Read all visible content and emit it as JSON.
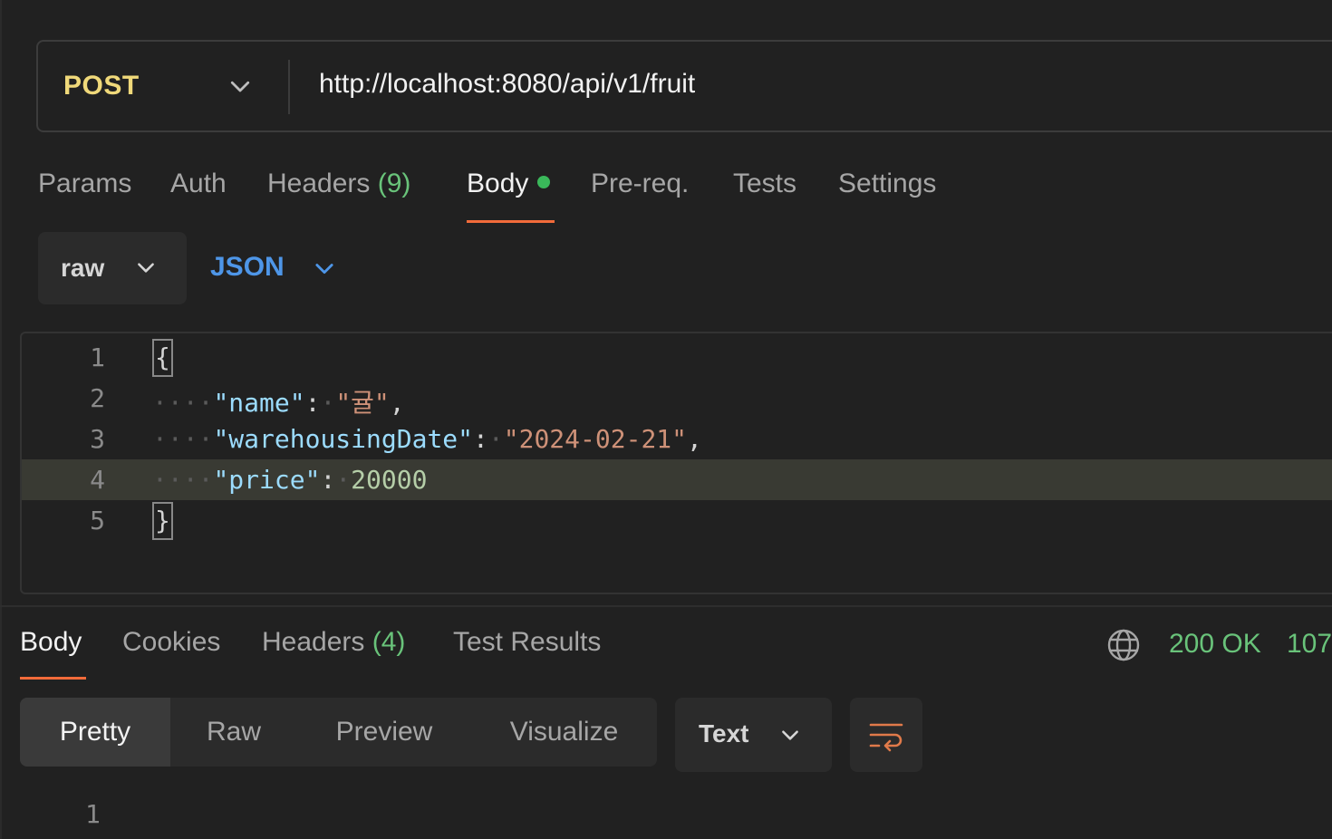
{
  "request": {
    "method": "POST",
    "url": "http://localhost:8080/api/v1/fruit"
  },
  "request_tabs": {
    "params": "Params",
    "auth": "Auth",
    "headers": "Headers",
    "headers_count": "(9)",
    "body": "Body",
    "prereq": "Pre-req.",
    "tests": "Tests",
    "settings": "Settings",
    "active": "Body"
  },
  "body_options": {
    "mode": "raw",
    "language": "JSON"
  },
  "editor": {
    "line_numbers": [
      "1",
      "2",
      "3",
      "4",
      "5"
    ],
    "open_brace": "{",
    "close_brace": "}",
    "lines": [
      {
        "key": "\"name\"",
        "value": "\"귤\"",
        "trail": ","
      },
      {
        "key": "\"warehousingDate\"",
        "value": "\"2024-02-21\"",
        "trail": ","
      },
      {
        "key": "\"price\"",
        "value": "20000",
        "trail": ""
      }
    ],
    "highlighted_line": 4
  },
  "response_tabs": {
    "body": "Body",
    "cookies": "Cookies",
    "headers": "Headers",
    "headers_count": "(4)",
    "test_results": "Test Results",
    "active": "Body"
  },
  "response_status": {
    "status": "200 OK",
    "time": "107"
  },
  "view_modes": {
    "pretty": "Pretty",
    "raw": "Raw",
    "preview": "Preview",
    "visualize": "Visualize",
    "active": "Pretty"
  },
  "response_format": "Text",
  "response_line_numbers": [
    "1"
  ],
  "colors": {
    "method": "#f0d97a",
    "accent": "#f26b3a",
    "success": "#69c37a",
    "json_link": "#4e96e8"
  }
}
